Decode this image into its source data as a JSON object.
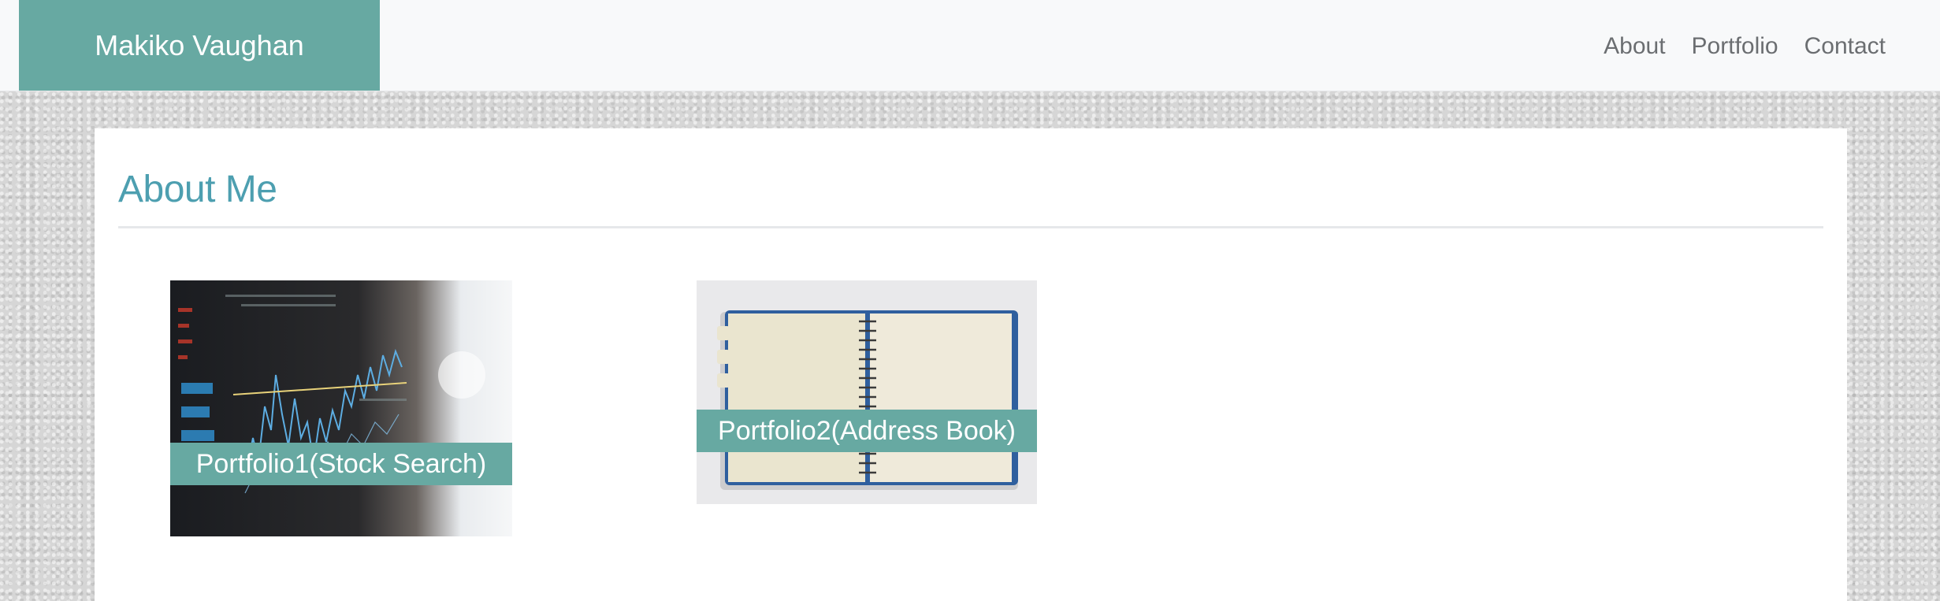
{
  "brand": {
    "name": "Makiko Vaughan"
  },
  "nav": {
    "items": [
      "About",
      "Portfolio",
      "Contact"
    ]
  },
  "main": {
    "heading": "About Me",
    "portfolios": [
      {
        "title": "Portfolio1(Stock Search)",
        "image": "stock-chart-screen"
      },
      {
        "title": "Portfolio2(Address Book)",
        "image": "spiral-notebook"
      }
    ]
  },
  "colors": {
    "accent": "#67a9a2",
    "heading": "#4d9fb0",
    "nav_text": "#6b6e71",
    "navbar_bg": "#f8f9fa",
    "card_bg": "#ffffff",
    "page_bg": "#d6d6d6"
  }
}
